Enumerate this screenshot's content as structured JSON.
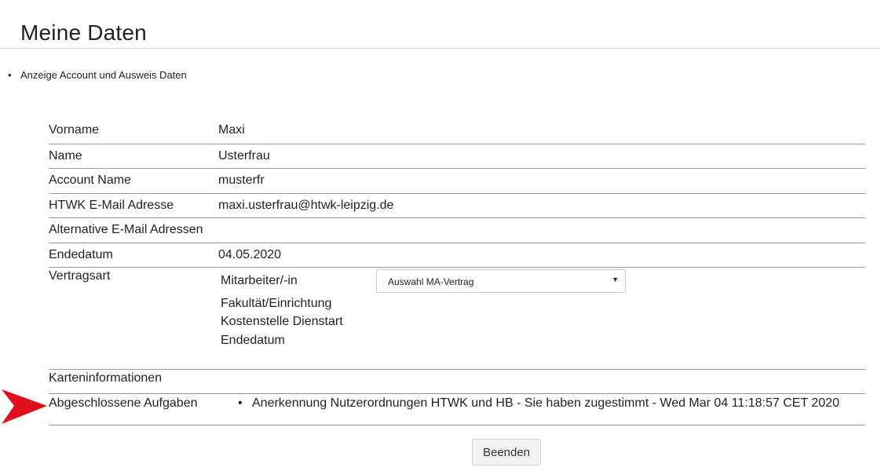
{
  "page": {
    "title": "Meine Daten",
    "intro": "Anzeige Account und Ausweis Daten"
  },
  "fields": {
    "vorname": {
      "label": "Vorname",
      "value": "Maxi"
    },
    "name": {
      "label": "Name",
      "value": "Usterfrau"
    },
    "account": {
      "label": "Account Name",
      "value": "musterfr"
    },
    "email": {
      "label": "HTWK E-Mail Adresse",
      "value": "maxi.usterfrau@htwk-leipzig.de"
    },
    "alt_email": {
      "label": "Alternative E-Mail Adressen",
      "value": ""
    },
    "endedatum": {
      "label": "Endedatum",
      "value": "04.05.2020"
    }
  },
  "vertragsart": {
    "label": "Vertragsart",
    "role": "Mitarbeiter/-in",
    "select_value": "Auswahl MA-Vertrag",
    "sub_labels": [
      "Fakultät/Einrichtung",
      "Kostenstelle Dienstart",
      "Endedatum"
    ]
  },
  "karteninformationen": {
    "label": "Karteninformationen"
  },
  "aufgaben": {
    "label": "Abgeschlossene Aufgaben",
    "items": [
      "Anerkennung Nutzerordnungen HTWK und HB - Sie haben zugestimmt - Wed Mar 04 11:18:57 CET 2020"
    ]
  },
  "colors": {
    "arrow": "#e0101a"
  },
  "icons": {
    "select_caret": "caret-down-icon",
    "pointer": "red-arrow-icon"
  },
  "buttons": {
    "finish": "Beenden"
  }
}
